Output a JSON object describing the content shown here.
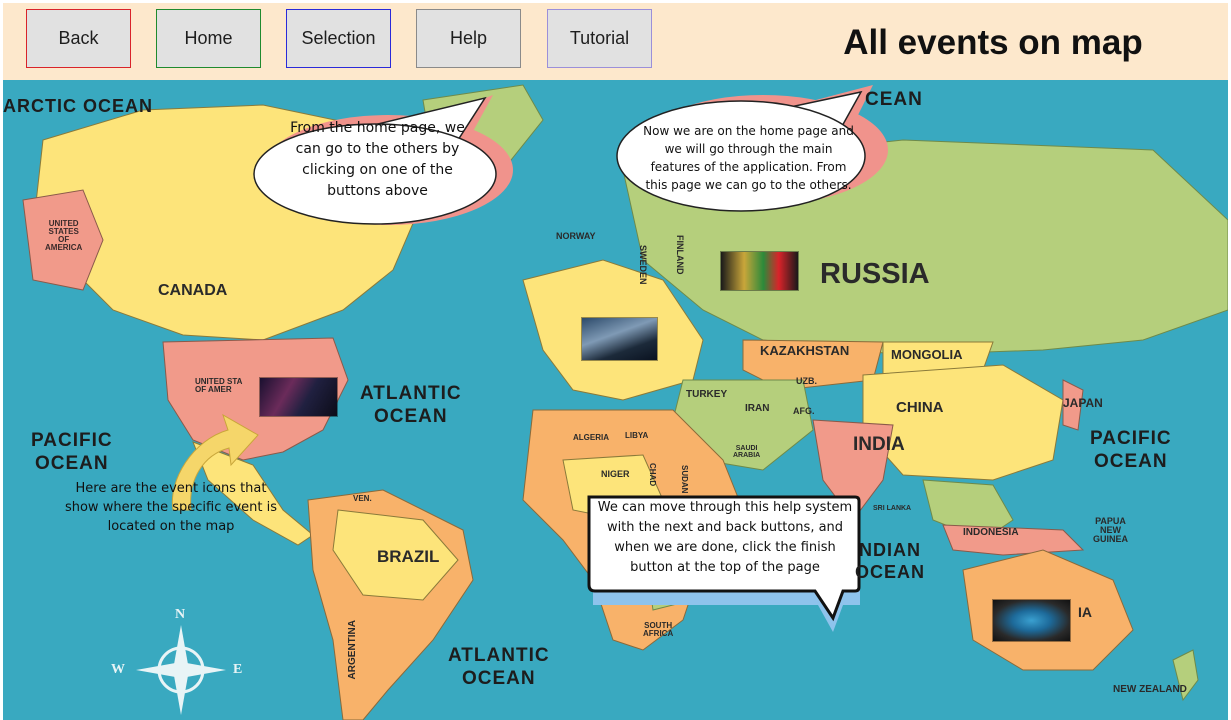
{
  "toolbar": {
    "buttons": [
      {
        "label": "Back",
        "border_color": "#d9232a"
      },
      {
        "label": "Home",
        "border_color": "#1f8a2e"
      },
      {
        "label": "Selection",
        "border_color": "#2a2ad9"
      },
      {
        "label": "Help",
        "border_color": "#8a8a8a"
      },
      {
        "label": "Tutorial",
        "border_color": "#9b8fd9"
      }
    ],
    "title": "All events on map"
  },
  "map": {
    "country_labels": [
      "UNITED\nSTATES\nOF\nAMERICA",
      "CANADA",
      "NORWAY",
      "SWEDEN",
      "FINLAND",
      "RUSSIA",
      "KAZAKHSTAN",
      "MONGOLIA",
      "CHINA",
      "INDIA",
      "IRAN",
      "AFG.",
      "TURKEY",
      "UZB.",
      "JAPAN",
      "ALGERIA",
      "LIBYA",
      "NIGER",
      "CHAD",
      "SUDAN",
      "SAUDI\nARABIA",
      "INDONESIA",
      "PAPUA\nNEW\nGUINEA",
      "BRAZIL",
      "ARGENTINA",
      "SOUTH\nAFRICA",
      "NEW ZEALAND",
      "VEN.",
      "UNITED STA\nOF AMER",
      "SRI LANKA",
      "IA"
    ],
    "ocean_labels": [
      "ARCTIC OCEAN",
      "CEAN",
      "ATLANTIC\nOCEAN",
      "PACIFIC\nOCEAN",
      "PACIFIC\nOCEAN",
      "NDIAN\nOCEAN",
      "ATLANTIC\nOCEAN"
    ],
    "compass": {
      "north": "N",
      "west": "W",
      "east": "E"
    },
    "colors": {
      "ocean": "#39a9c0",
      "land_green": "#b5cf7c",
      "land_yellow": "#fde47a",
      "land_orange": "#f8b26a",
      "land_pink": "#f19a8a"
    }
  },
  "bubbles": {
    "home_page": "From the home page, we can go to the others by clicking on one of the buttons above",
    "features": "Now we are on the home page and we will go through the main features of the application. From this page we can go to the others.",
    "navigation": "We can move through this help system with the next and back buttons, and when we are done, click the finish button at the top of the page"
  },
  "hint": "Here are the event icons that show where the specific event is located on the map",
  "events": [
    {
      "icon": "concert-event-icon"
    },
    {
      "icon": "stadium-event-icon"
    },
    {
      "icon": "world-cup-event-icon"
    },
    {
      "icon": "arena-event-icon"
    }
  ]
}
